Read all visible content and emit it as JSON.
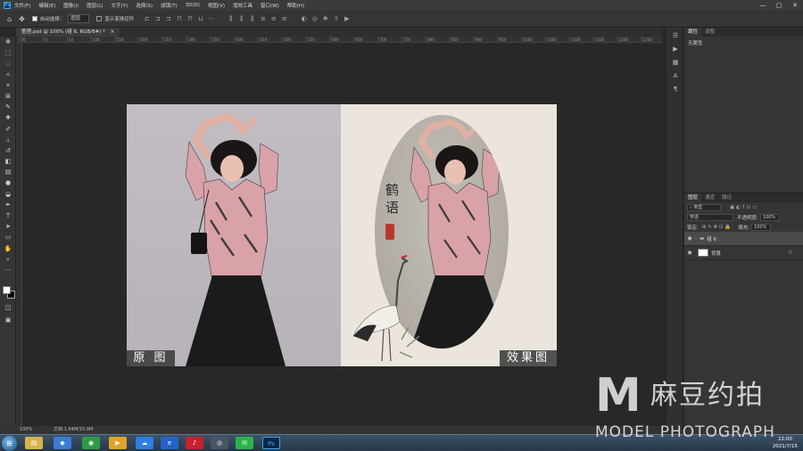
{
  "menubar": {
    "items": [
      "文件(F)",
      "编辑(E)",
      "图像(I)",
      "图层(L)",
      "文字(Y)",
      "选择(S)",
      "滤镜(T)",
      "3D(D)",
      "视图(V)",
      "增效工具",
      "窗口(W)",
      "帮助(H)"
    ],
    "logo": "Ps",
    "window_controls": [
      "—",
      "▢",
      "✕"
    ]
  },
  "options": {
    "auto_select_label": "自动选择：",
    "auto_select_value": "图层",
    "show_transform_label": "显示变换控件"
  },
  "document": {
    "tab_title": "整理.psd @ 100% (组 6, RGB/8#) *",
    "tab_close": "×"
  },
  "ruler": {
    "ticks": [
      "50",
      "0",
      "50",
      "100",
      "150",
      "200",
      "250",
      "300",
      "350",
      "400",
      "450",
      "500",
      "550",
      "600",
      "650",
      "700",
      "750",
      "800",
      "850",
      "900",
      "950",
      "1000",
      "1050",
      "1100",
      "1150",
      "1200",
      "1250"
    ]
  },
  "artboard": {
    "label_original": "原 图",
    "label_effect": "效果图",
    "calligraphy": "鹤语",
    "colors": {
      "left_bg": "#c2bcc3",
      "right_bg": "#ebe5dd",
      "shirt": "#d7a0a7",
      "skirt": "#1c1b1c",
      "hair": "#1a1616"
    }
  },
  "status": {
    "zoom": "100%",
    "doc_size": "文档:1.64M/15.0M"
  },
  "properties": {
    "tabs": [
      "属性",
      "调整"
    ],
    "empty_text": "无属性"
  },
  "layers": {
    "tabs": [
      "图层",
      "通道",
      "路径"
    ],
    "filter_label": "类型",
    "blend_mode": "穿透",
    "opacity_label": "不透明度:",
    "opacity_value": "100%",
    "lock_label": "锁定:",
    "fill_label": "填充:",
    "fill_value": "100%",
    "items": [
      {
        "name": "组 6",
        "type": "group"
      },
      {
        "name": "背景",
        "type": "background"
      }
    ]
  },
  "taskbar": {
    "time": "22:00",
    "date": "2021/7/15",
    "active_app": "Ps"
  },
  "watermark": {
    "letter": "M",
    "chinese": "麻豆约拍",
    "english": "MODEL PHOTOGRAPH"
  }
}
